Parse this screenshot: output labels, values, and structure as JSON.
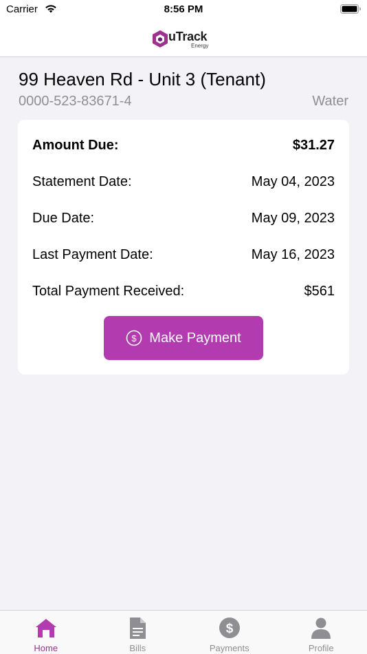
{
  "status_bar": {
    "carrier": "Carrier",
    "time": "8:56 PM"
  },
  "nav": {
    "logo_word": "uTrack",
    "logo_sub": "Energy"
  },
  "account": {
    "title": "99 Heaven Rd - Unit 3 (Tenant)",
    "number": "0000-523-83671-4",
    "utility": "Water"
  },
  "summary": {
    "amount_due_label": "Amount Due:",
    "amount_due_value": "$31.27",
    "statement_date_label": "Statement Date:",
    "statement_date_value": "May 04, 2023",
    "due_date_label": "Due Date:",
    "due_date_value": "May 09, 2023",
    "last_payment_label": "Last Payment Date:",
    "last_payment_value": "May 16, 2023",
    "total_received_label": "Total Payment Received:",
    "total_received_value": "$561",
    "make_payment_label": "Make Payment"
  },
  "tabs": [
    {
      "label": "Home",
      "icon": "home-icon",
      "active": true
    },
    {
      "label": "Bills",
      "icon": "document-icon",
      "active": false
    },
    {
      "label": "Payments",
      "icon": "dollar-circle-icon",
      "active": false
    },
    {
      "label": "Profile",
      "icon": "person-icon",
      "active": false
    }
  ],
  "colors": {
    "accent": "#b23bb0",
    "tab_active": "#a0308f",
    "tab_inactive": "#8e8e93",
    "background": "#f2f2f7"
  }
}
